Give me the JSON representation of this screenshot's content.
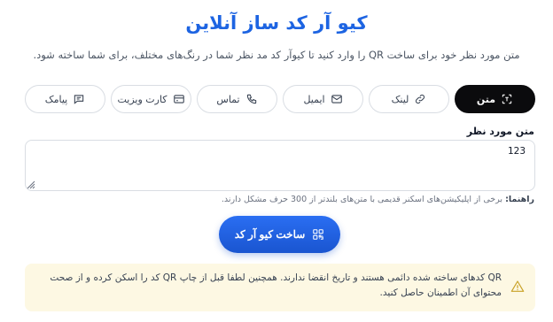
{
  "page": {
    "title": "کیو آر کد ساز آنلاین",
    "subtitle": "متن مورد نظر خود برای ساخت QR را وارد کنید تا کیوآر کد مد نظر شما در رنگ‌های مختلف، برای شما ساخته شود."
  },
  "tabs": [
    {
      "label": "متن",
      "icon": "text-scan-icon",
      "active": true
    },
    {
      "label": "لینک",
      "icon": "link-icon",
      "active": false
    },
    {
      "label": "ایمیل",
      "icon": "mail-icon",
      "active": false
    },
    {
      "label": "تماس",
      "icon": "phone-icon",
      "active": false
    },
    {
      "label": "کارت ویزیت",
      "icon": "card-icon",
      "active": false
    },
    {
      "label": "پیامک",
      "icon": "message-icon",
      "active": false
    }
  ],
  "form": {
    "label": "متن مورد نظر",
    "value": "123",
    "hint_prefix": "راهنما:",
    "hint": "برخی از اپلیکیشن‌های اسکنر قدیمی با متن‌های بلندتر از 300 حرف مشکل دارند."
  },
  "generate": {
    "label": "ساخت کیو آر کد",
    "icon": "qr-icon"
  },
  "notice": {
    "icon": "warning-icon",
    "text": "QR کدهای ساخته شده دائمی هستند و تاریخ انقضا ندارند. همچنین لطفا قبل از چاپ QR کد را اسکن کرده و از صحت محتوای آن اطمینان حاصل کنید."
  },
  "colors": {
    "accent": "#1d64e2",
    "active_tab": "#0b0b0d",
    "notice_bg": "#fdf8e3",
    "warning": "#c9a227"
  }
}
